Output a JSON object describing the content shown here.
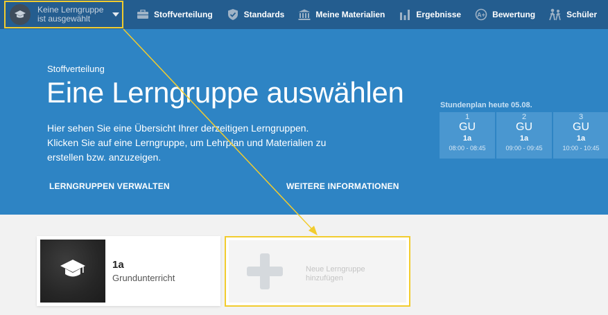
{
  "topnav": {
    "group_select": {
      "line1": "Keine Lerngruppe",
      "line2": "ist ausgewählt"
    },
    "items": [
      {
        "label": "Stoffverteilung",
        "icon": "briefcase-icon"
      },
      {
        "label": "Standards",
        "icon": "shield-check-icon"
      },
      {
        "label": "Meine Materialien",
        "icon": "library-icon"
      },
      {
        "label": "Ergebnisse",
        "icon": "bar-chart-icon"
      },
      {
        "label": "Bewertung",
        "icon": "rating-badge-icon"
      },
      {
        "label": "Schüler",
        "icon": "students-icon"
      }
    ]
  },
  "hero": {
    "subtitle": "Stoffverteilung",
    "title": "Eine Lerngruppe auswählen",
    "description": "Hier sehen Sie eine Übersicht Ihrer derzeitigen Lerngruppen. Klicken Sie auf eine Lerngruppe, um Lehrplan und Materialien zu erstellen bzw. anzuzeigen.",
    "link_manage": "LERNGRUPPEN VERWALTEN",
    "link_info": "WEITERE INFORMATIONEN"
  },
  "schedule": {
    "label": "Stundenplan heute 05.08.",
    "slots": [
      {
        "number": "1",
        "subject": "GU",
        "class": "1a",
        "time": "08:00 - 08:45"
      },
      {
        "number": "2",
        "subject": "GU",
        "class": "1a",
        "time": "09:00 - 09:45"
      },
      {
        "number": "3",
        "subject": "GU",
        "class": "1a",
        "time": "10:00 - 10:45"
      }
    ]
  },
  "groups": [
    {
      "title": "1a",
      "subtitle": "Grundunterricht",
      "icon": "graduation-cap-icon"
    }
  ],
  "add_group": {
    "line1": "Neue Lerngruppe",
    "line2": "hinzufügen",
    "icon": "plus-icon"
  },
  "colors": {
    "nav_bg": "#245d8f",
    "hero_bg": "#2e84c4",
    "slot_bg": "#4a97d0",
    "highlight": "#f2cc2e",
    "page_bg": "#f2f2f2"
  }
}
